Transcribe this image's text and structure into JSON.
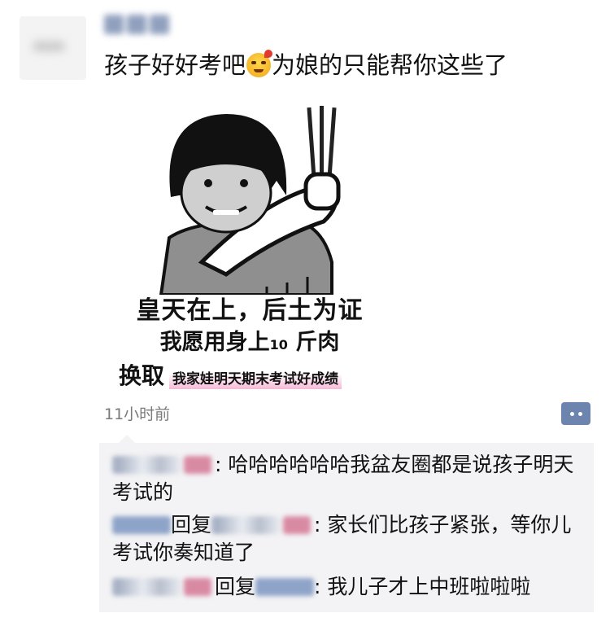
{
  "post": {
    "text_before_emoji": "孩子好好考吧",
    "text_after_emoji": "为娘的只能帮你这些了",
    "emoji_icon": "angry-face-emoji",
    "meme": {
      "line1": "皇天在上，后土为证",
      "line2_before": "我愿用身上",
      "line2_number": "10",
      "line2_after": " 斤肉",
      "line3_main": "换取",
      "line3_pink": "我家娃明天期末考试好成绩"
    },
    "timestamp": "11小时前"
  },
  "comments": [
    {
      "text": ": 哈哈哈哈哈哈我盆友圈都是说孩子明天考试的"
    },
    {
      "reply_label": "回复",
      "text": ": 家长们比孩子紧张，等你儿考试你奏知道了"
    },
    {
      "reply_label": "回复",
      "text": ": 我儿子才上中班啦啦啦"
    }
  ],
  "colors": {
    "accent": "#6d84ae",
    "comment_bg": "#f3f3f5",
    "pink_highlight": "#f6b9d6"
  }
}
